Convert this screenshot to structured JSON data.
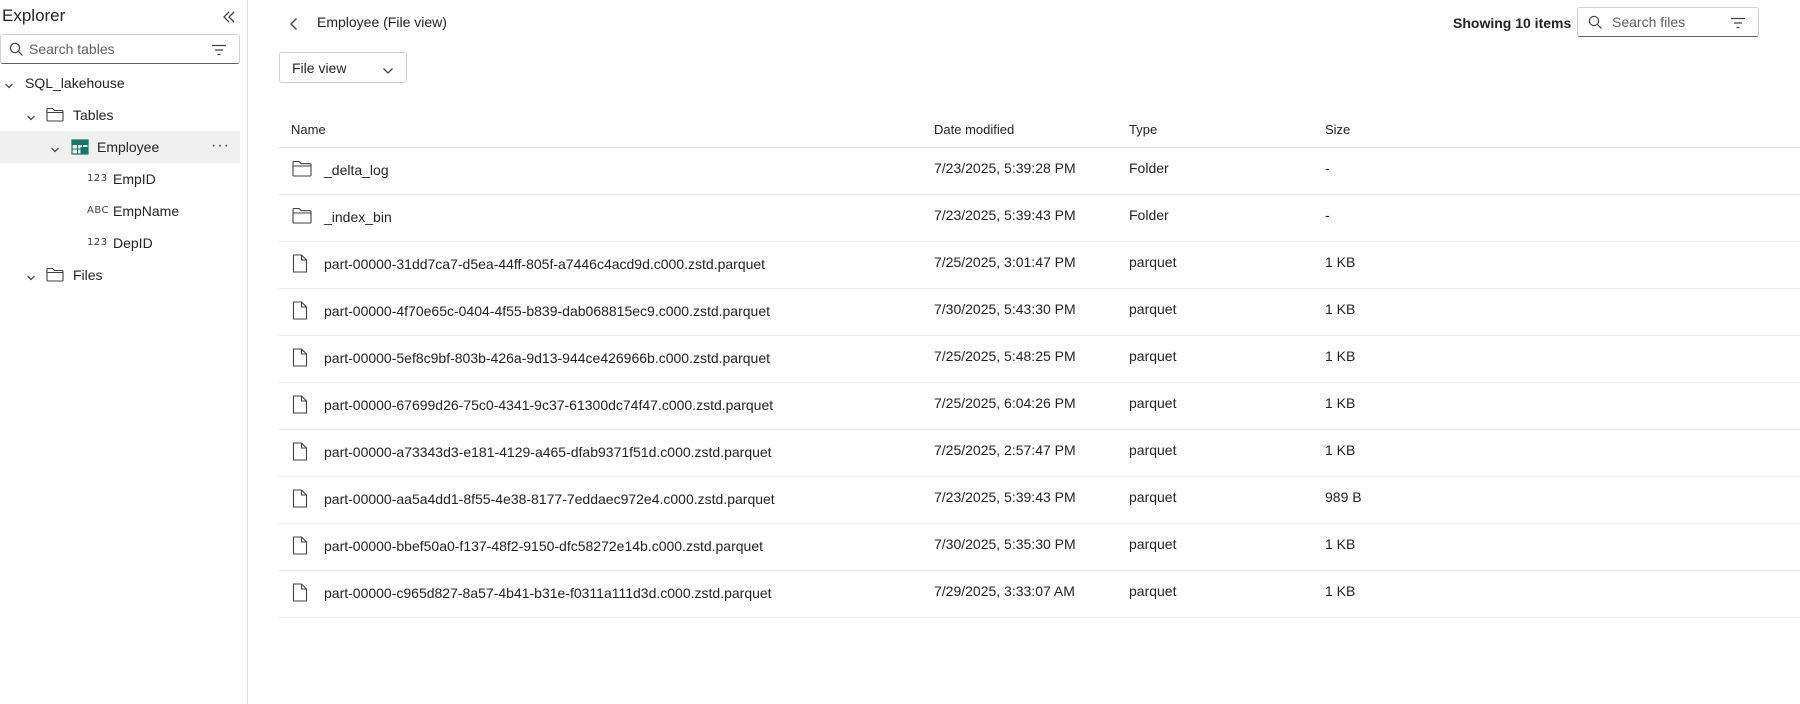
{
  "sidebar": {
    "title": "Explorer",
    "search_placeholder": "Search tables",
    "tree": {
      "lakehouse": "SQL_lakehouse",
      "tables_label": "Tables",
      "table_name": "Employee",
      "more_label": "···",
      "columns": [
        {
          "type": "123",
          "name": "EmpID"
        },
        {
          "type": "ABC",
          "name": "EmpName"
        },
        {
          "type": "123",
          "name": "DepID"
        }
      ],
      "files_label": "Files"
    }
  },
  "main": {
    "title": "Employee (File view)",
    "showing": "Showing 10 items",
    "search_placeholder": "Search files",
    "view_selector": "File view",
    "columns": {
      "name": "Name",
      "date": "Date modified",
      "type": "Type",
      "size": "Size"
    },
    "rows": [
      {
        "icon": "folder-icon",
        "name": "_delta_log",
        "date": "7/23/2025, 5:39:28 PM",
        "type": "Folder",
        "size": "-"
      },
      {
        "icon": "folder-icon",
        "name": "_index_bin",
        "date": "7/23/2025, 5:39:43 PM",
        "type": "Folder",
        "size": "-"
      },
      {
        "icon": "file-icon",
        "name": "part-00000-31dd7ca7-d5ea-44ff-805f-a7446c4acd9d.c000.zstd.parquet",
        "date": "7/25/2025, 3:01:47 PM",
        "type": "parquet",
        "size": "1 KB"
      },
      {
        "icon": "file-icon",
        "name": "part-00000-4f70e65c-0404-4f55-b839-dab068815ec9.c000.zstd.parquet",
        "date": "7/30/2025, 5:43:30 PM",
        "type": "parquet",
        "size": "1 KB"
      },
      {
        "icon": "file-icon",
        "name": "part-00000-5ef8c9bf-803b-426a-9d13-944ce426966b.c000.zstd.parquet",
        "date": "7/25/2025, 5:48:25 PM",
        "type": "parquet",
        "size": "1 KB"
      },
      {
        "icon": "file-icon",
        "name": "part-00000-67699d26-75c0-4341-9c37-61300dc74f47.c000.zstd.parquet",
        "date": "7/25/2025, 6:04:26 PM",
        "type": "parquet",
        "size": "1 KB"
      },
      {
        "icon": "file-icon",
        "name": "part-00000-a73343d3-e181-4129-a465-dfab9371f51d.c000.zstd.parquet",
        "date": "7/25/2025, 2:57:47 PM",
        "type": "parquet",
        "size": "1 KB"
      },
      {
        "icon": "file-icon",
        "name": "part-00000-aa5a4dd1-8f55-4e38-8177-7eddaec972e4.c000.zstd.parquet",
        "date": "7/23/2025, 5:39:43 PM",
        "type": "parquet",
        "size": "989 B"
      },
      {
        "icon": "file-icon",
        "name": "part-00000-bbef50a0-f137-48f2-9150-dfc58272e14b.c000.zstd.parquet",
        "date": "7/30/2025, 5:35:30 PM",
        "type": "parquet",
        "size": "1 KB"
      },
      {
        "icon": "file-icon",
        "name": "part-00000-c965d827-8a57-4b41-b31e-f0311a111d3d.c000.zstd.parquet",
        "date": "7/29/2025, 3:33:07 AM",
        "type": "parquet",
        "size": "1 KB"
      }
    ]
  },
  "colors": {
    "table_icon_accent": "#117865",
    "border": "#e0e0e0",
    "selected_bg": "#f0f0f0"
  }
}
